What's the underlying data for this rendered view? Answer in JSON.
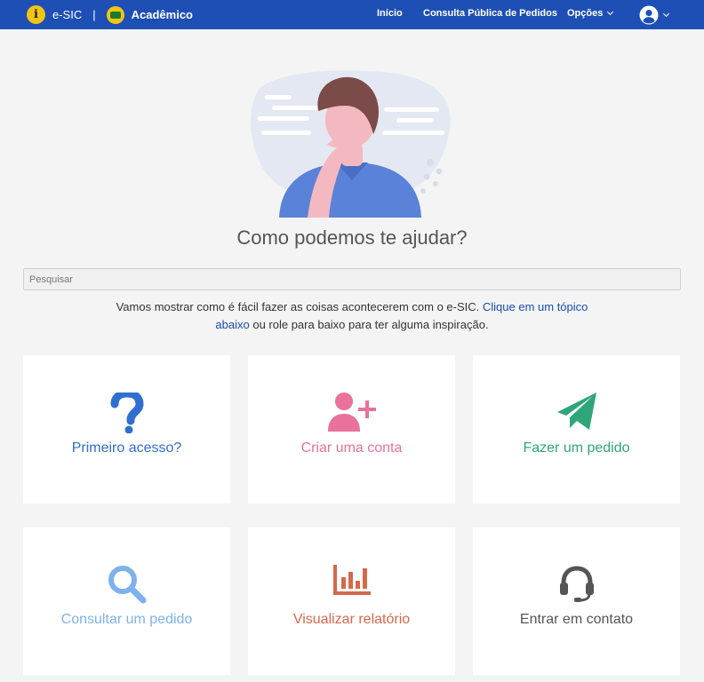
{
  "navbar": {
    "logo_glyph": "i",
    "brand": "e-SIC",
    "separator": "|",
    "institution": "Acadêmico",
    "links": [
      "Início",
      "Consulta Pública de Pedidos",
      "Opções"
    ],
    "user_icon": "user-circle-icon",
    "background_color": "#1e4fb4"
  },
  "main": {
    "title": "Como podemos te ajudar?",
    "search": {
      "placeholder": "Pesquisar",
      "value": ""
    },
    "intro": {
      "text_before": "Vamos mostrar como é fácil fazer as coisas acontecerem com o e-SIC. ",
      "link": "Clique em um tópico abaixo",
      "text_after": " ou role para baixo para ter alguma inspiração."
    }
  },
  "cards": [
    {
      "label": "Primeiro acesso?",
      "icon": "question-icon",
      "color": "#2f6fcf"
    },
    {
      "label": "Criar uma conta",
      "icon": "user-plus-icon",
      "color": "#e8729b"
    },
    {
      "label": "Fazer um pedido",
      "icon": "paper-plane-icon",
      "color": "#2fa57a"
    },
    {
      "label": "Consultar um pedido",
      "icon": "search-icon",
      "color": "#7db2ec"
    },
    {
      "label": "Visualizar relatório",
      "icon": "bar-chart-icon",
      "color": "#d4694a"
    },
    {
      "label": "Entrar em contato",
      "icon": "headset-icon",
      "color": "#555555"
    }
  ]
}
